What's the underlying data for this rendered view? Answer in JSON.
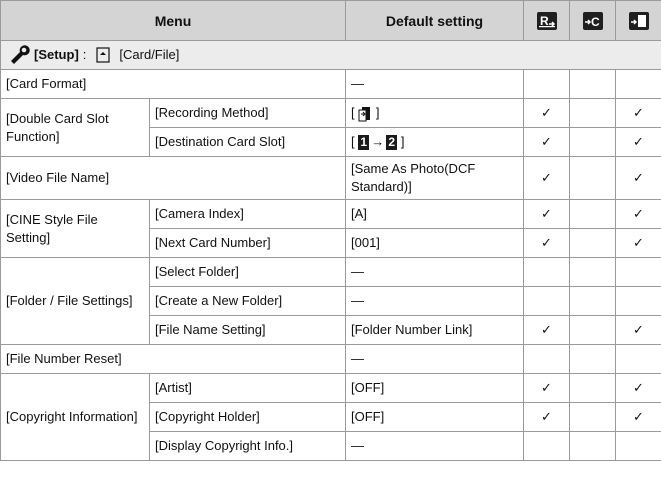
{
  "header": {
    "menu": "Menu",
    "default_setting": "Default setting",
    "col_icons": [
      "r-reset-icon",
      "c-reset-icon",
      "custom-save-icon"
    ]
  },
  "section": {
    "label": "[Setup]",
    "sep": ":",
    "tab_label": "[Card/File]"
  },
  "rows": [
    {
      "group": "[Card Format]",
      "item": "",
      "value": "—",
      "c1": "",
      "c2": "",
      "c3": ""
    },
    {
      "group": "[Double Card Slot Function]",
      "item": "[Recording Method]",
      "value_prefix": "[",
      "value_suffix": "]",
      "c1": "✓",
      "c2": "",
      "c3": "✓"
    },
    {
      "group": "",
      "item": "[Destination Card Slot]",
      "value_prefix": "[",
      "slot_from": "1",
      "slot_arrow": "→",
      "slot_to": "2",
      "value_suffix": "]",
      "c1": "✓",
      "c2": "",
      "c3": "✓"
    },
    {
      "group": "[Video File Name]",
      "item": "",
      "value": "[Same As Photo(DCF Standard)]",
      "c1": "✓",
      "c2": "",
      "c3": "✓"
    },
    {
      "group": "[CINE Style File Setting]",
      "item": "[Camera Index]",
      "value": "[A]",
      "c1": "✓",
      "c2": "",
      "c3": "✓"
    },
    {
      "group": "",
      "item": "[Next Card Number]",
      "value": "[001]",
      "c1": "✓",
      "c2": "",
      "c3": "✓"
    },
    {
      "group": "[Folder / File Settings]",
      "item": "[Select Folder]",
      "value": "—",
      "c1": "",
      "c2": "",
      "c3": ""
    },
    {
      "group": "",
      "item": "[Create a New Folder]",
      "value": "—",
      "c1": "",
      "c2": "",
      "c3": ""
    },
    {
      "group": "",
      "item": "[File Name Setting]",
      "value": "[Folder Number Link]",
      "c1": "✓",
      "c2": "",
      "c3": "✓"
    },
    {
      "group": "[File Number Reset]",
      "item": "",
      "value": "—",
      "c1": "",
      "c2": "",
      "c3": ""
    },
    {
      "group": "[Copyright Information]",
      "item": "[Artist]",
      "value": "[OFF]",
      "c1": "✓",
      "c2": "",
      "c3": "✓"
    },
    {
      "group": "",
      "item": "[Copyright Holder]",
      "value": "[OFF]",
      "c1": "✓",
      "c2": "",
      "c3": "✓"
    },
    {
      "group": "",
      "item": "[Display Copyright Info.]",
      "value": "—",
      "c1": "",
      "c2": "",
      "c3": ""
    }
  ]
}
